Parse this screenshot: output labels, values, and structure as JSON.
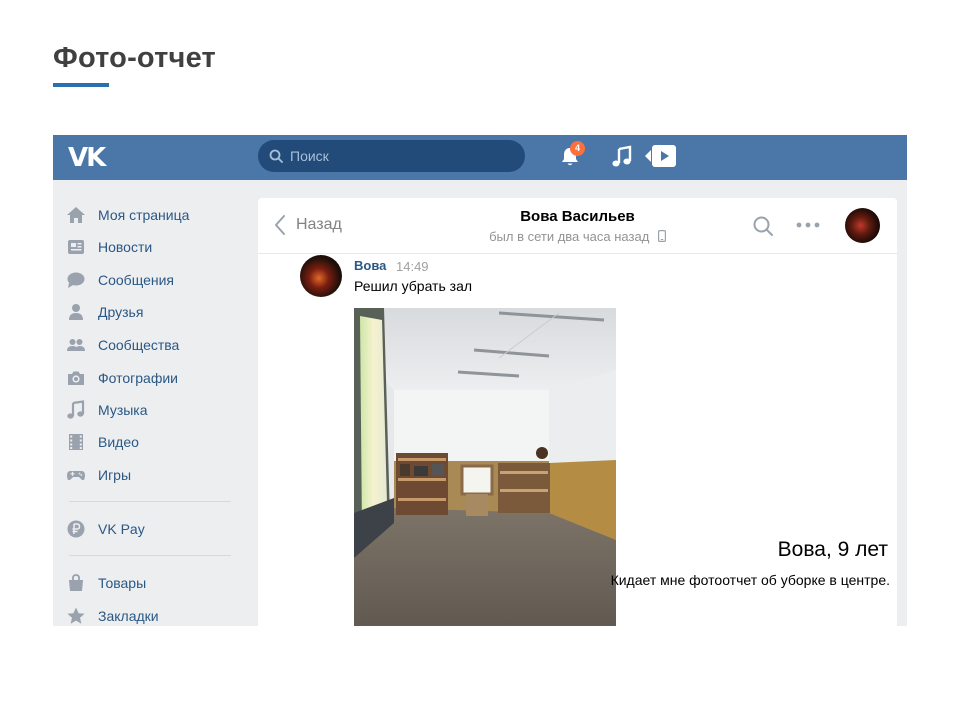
{
  "slide": {
    "title": "Фото-отчет",
    "accent_color": "#2a6fb0"
  },
  "vk": {
    "brand_color": "#4a76a8",
    "header": {
      "logo": "VK",
      "search_placeholder": "Поиск",
      "notifications_count": "4",
      "icons": [
        "bell-icon",
        "music-icon",
        "video-play-icon"
      ]
    },
    "sidebar": {
      "items": [
        {
          "label": "Моя страница",
          "icon": "home-icon"
        },
        {
          "label": "Новости",
          "icon": "news-icon"
        },
        {
          "label": "Сообщения",
          "icon": "messages-icon"
        },
        {
          "label": "Друзья",
          "icon": "friends-icon"
        },
        {
          "label": "Сообщества",
          "icon": "communities-icon"
        },
        {
          "label": "Фотографии",
          "icon": "camera-icon"
        },
        {
          "label": "Музыка",
          "icon": "music-note-icon"
        },
        {
          "label": "Видео",
          "icon": "film-icon"
        },
        {
          "label": "Игры",
          "icon": "gamepad-icon"
        },
        {
          "label": "VK Pay",
          "icon": "ruble-icon"
        },
        {
          "label": "Товары",
          "icon": "bag-icon"
        },
        {
          "label": "Закладки",
          "icon": "star-icon"
        }
      ]
    },
    "chat": {
      "back_label": "Назад",
      "peer_name": "Вова Васильев",
      "peer_status": "был в сети два часа назад",
      "message": {
        "author": "Вова",
        "time": "14:49",
        "text": "Решил убрать зал"
      }
    }
  },
  "caption": {
    "name": "Вова, 9 лет",
    "description": "Кидает мне фотоотчет об уборке в центре."
  }
}
